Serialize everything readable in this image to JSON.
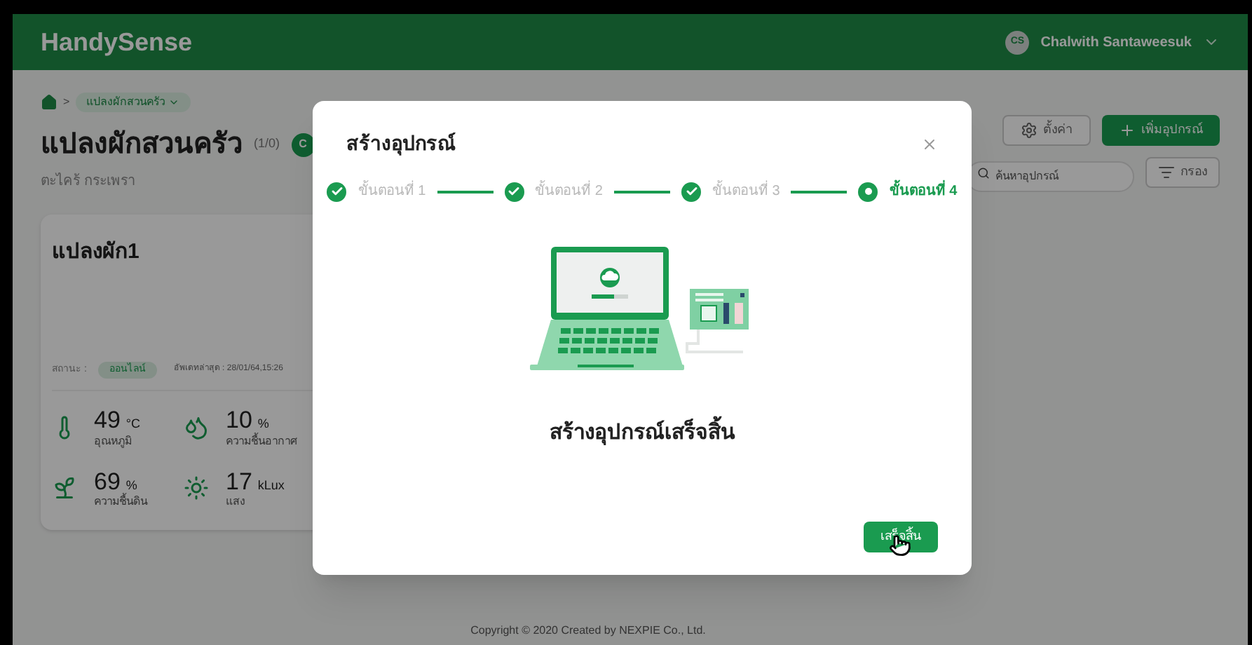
{
  "header": {
    "brand": "HandySense",
    "user": {
      "initials": "CS",
      "name": "Chalwith Santaweesuk"
    }
  },
  "breadcrumb": {
    "separator": ">",
    "current": "แปลงผักสวนครัว"
  },
  "farm": {
    "title": "แปลงผักสวนครัว",
    "count": "(1/0)",
    "badge": "C",
    "subtitle": "ตะไคร้ กระเพรา"
  },
  "actions": {
    "settings": "ตั้งค่า",
    "add": "เพิ่มอุปกรณ์",
    "search": {
      "placeholder": "ค้นหาอุปกรณ์"
    },
    "filter": "กรอง"
  },
  "card": {
    "title": "แปลงผัก1",
    "status_label": "สถานะ :",
    "status": "ออนไลน์",
    "updated": "อัพเดทล่าสุด : 28/01/64,15:26",
    "sensors": [
      {
        "kind": "temperature",
        "value": "49",
        "unit": "°C",
        "label": "อุณหภูมิ"
      },
      {
        "kind": "air_humidity",
        "value": "10",
        "unit": "%",
        "label": "ความชื้นอากาศ"
      },
      {
        "kind": "soil_moisture",
        "value": "69",
        "unit": "%",
        "label": "ความชื้นดิน"
      },
      {
        "kind": "light",
        "value": "17",
        "unit": "kLux",
        "label": "แสง"
      }
    ]
  },
  "modal": {
    "title": "สร้างอุปกรณ์",
    "steps": [
      {
        "label": "ขั้นตอนที่ 1",
        "completed": true,
        "selected": false
      },
      {
        "label": "ขั้นตอนที่ 2",
        "completed": true,
        "selected": false
      },
      {
        "label": "ขั้นตอนที่ 3",
        "completed": true,
        "selected": false
      },
      {
        "label": "ขั้นตอนที่ 4",
        "completed": false,
        "selected": true
      }
    ],
    "message": "สร้างอุปกรณ์เสร็จสิ้น",
    "button": "เสร็จสิ้น"
  },
  "footer": "Copyright © 2020 Created by NEXPIE Co., Ltd."
}
